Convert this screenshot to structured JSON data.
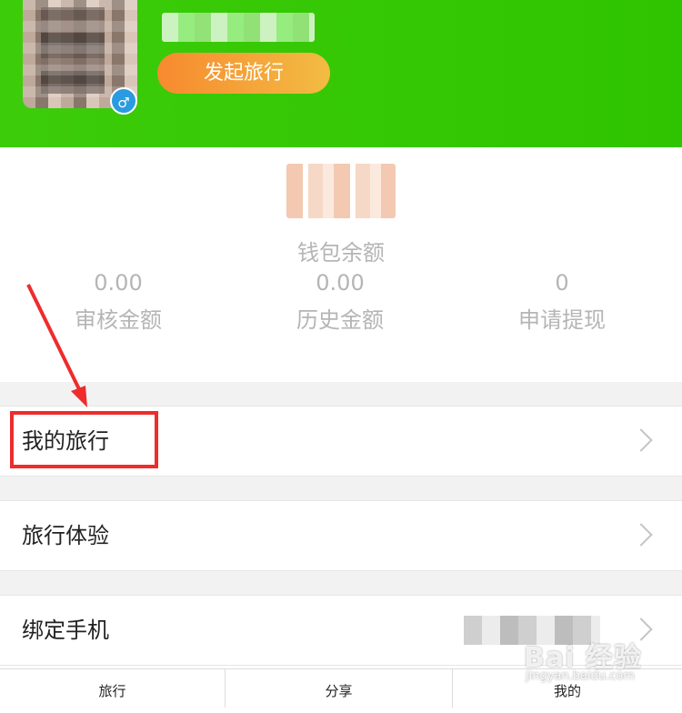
{
  "header": {
    "start_button": "发起旅行",
    "gender_icon": "male-icon"
  },
  "wallet": {
    "label": "钱包余额",
    "stats": [
      {
        "value": "0.00",
        "label": "审核金额"
      },
      {
        "value": "0.00",
        "label": "历史金额"
      },
      {
        "value": "0",
        "label": "申请提现"
      }
    ]
  },
  "menu": [
    {
      "label": "我的旅行"
    },
    {
      "label": "旅行体验"
    },
    {
      "label": "绑定手机"
    }
  ],
  "tabbar": {
    "tabs": [
      {
        "label": "旅行"
      },
      {
        "label": "分享"
      },
      {
        "label": "我的"
      }
    ]
  },
  "colors": {
    "header_green": "#2fc400",
    "start_button_orange": "#f78a2f",
    "highlight_red": "#ee2c2c"
  },
  "watermark": {
    "main": "Bai 经验",
    "sub": "jingyan.baidu.com"
  }
}
